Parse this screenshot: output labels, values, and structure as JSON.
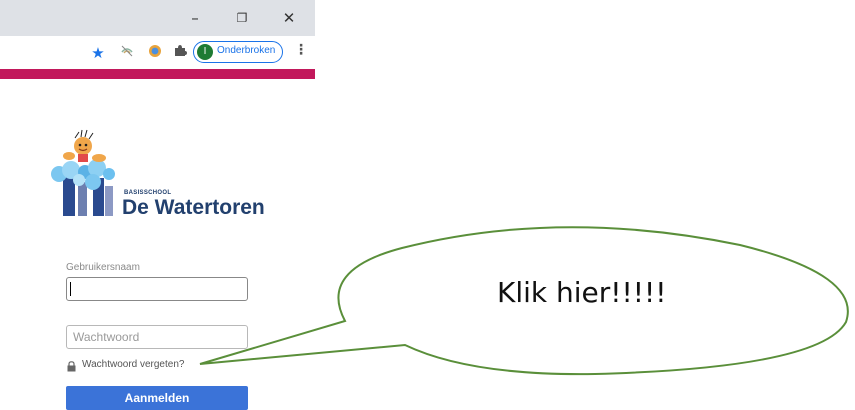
{
  "window": {
    "minimize_glyph": "–",
    "restore_glyph": "❐",
    "close_glyph": "✕"
  },
  "toolbar": {
    "profile_initial": "I",
    "profile_name": "Onderbroken",
    "icons": [
      "bookmark-star-icon",
      "extension-icon",
      "chrome-extension-icon",
      "puzzle-icon",
      "kebab-menu-icon"
    ]
  },
  "logo": {
    "small_text": "BASISSCHOOL",
    "big_text": "De Watertoren"
  },
  "form": {
    "username_label": "Gebruikersnaam",
    "username_value": "",
    "password_placeholder": "Wachtwoord",
    "forgot_label": "Wachtwoord vergeten?",
    "login_label": "Aanmelden"
  },
  "callout": {
    "text": "Klik hier!!!!!"
  },
  "colors": {
    "accent_bar": "#c2185b",
    "button": "#3b73d8",
    "logo_text": "#22406e",
    "profile_avatar": "#1e7b34"
  }
}
